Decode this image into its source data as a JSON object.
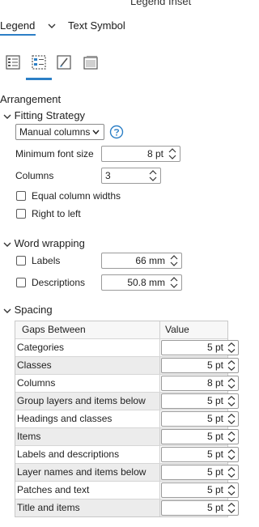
{
  "pane": {
    "title": "Legend Inset"
  },
  "tabs": {
    "legend": "Legend",
    "text_symbol": "Text Symbol"
  },
  "toolbar": [
    "options-icon",
    "arrangement-icon",
    "symbol-icon",
    "display-icon"
  ],
  "arrangement": {
    "heading": "Arrangement",
    "fitting": {
      "heading": "Fitting Strategy",
      "strategy": "Manual columns",
      "min_font_label": "Minimum font size",
      "min_font_value": "8 pt",
      "columns_label": "Columns",
      "columns_value": "3",
      "equal_widths_label": "Equal column widths",
      "rtl_label": "Right to left"
    },
    "wrapping": {
      "heading": "Word wrapping",
      "labels_label": "Labels",
      "labels_value": "66 mm",
      "desc_label": "Descriptions",
      "desc_value": "50.8 mm"
    },
    "spacing": {
      "heading": "Spacing",
      "col_gaps": "Gaps Between",
      "col_value": "Value",
      "rows": [
        {
          "name": "Categories",
          "value": "5 pt"
        },
        {
          "name": "Classes",
          "value": "5 pt"
        },
        {
          "name": "Columns",
          "value": "8 pt"
        },
        {
          "name": "Group layers and items below",
          "value": "5 pt"
        },
        {
          "name": "Headings and classes",
          "value": "5 pt"
        },
        {
          "name": "Items",
          "value": "5 pt"
        },
        {
          "name": "Labels and descriptions",
          "value": "5 pt"
        },
        {
          "name": "Layer names and items below",
          "value": "5 pt"
        },
        {
          "name": "Patches and text",
          "value": "5 pt"
        },
        {
          "name": "Title and items",
          "value": "5 pt"
        }
      ]
    }
  },
  "colors": {
    "accent": "#2c7fc6",
    "help": "#2c7fc6"
  }
}
